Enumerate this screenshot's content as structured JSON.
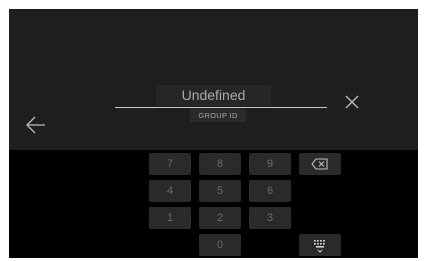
{
  "entry": {
    "value": "Undefined",
    "label": "GROUP ID"
  },
  "keypad": {
    "rows": [
      [
        "7",
        "8",
        "9"
      ],
      [
        "4",
        "5",
        "6"
      ],
      [
        "1",
        "2",
        "3"
      ],
      [
        "0"
      ]
    ]
  },
  "icons": {
    "back": "arrow-left-icon",
    "close": "close-icon",
    "backspace": "backspace-icon",
    "keyboard": "keyboard-hide-icon"
  },
  "colors": {
    "top_background": "#1e1e1e",
    "keypad_background": "#000000",
    "key_background": "#2a2a2a",
    "key_text": "#6b6b6b"
  }
}
